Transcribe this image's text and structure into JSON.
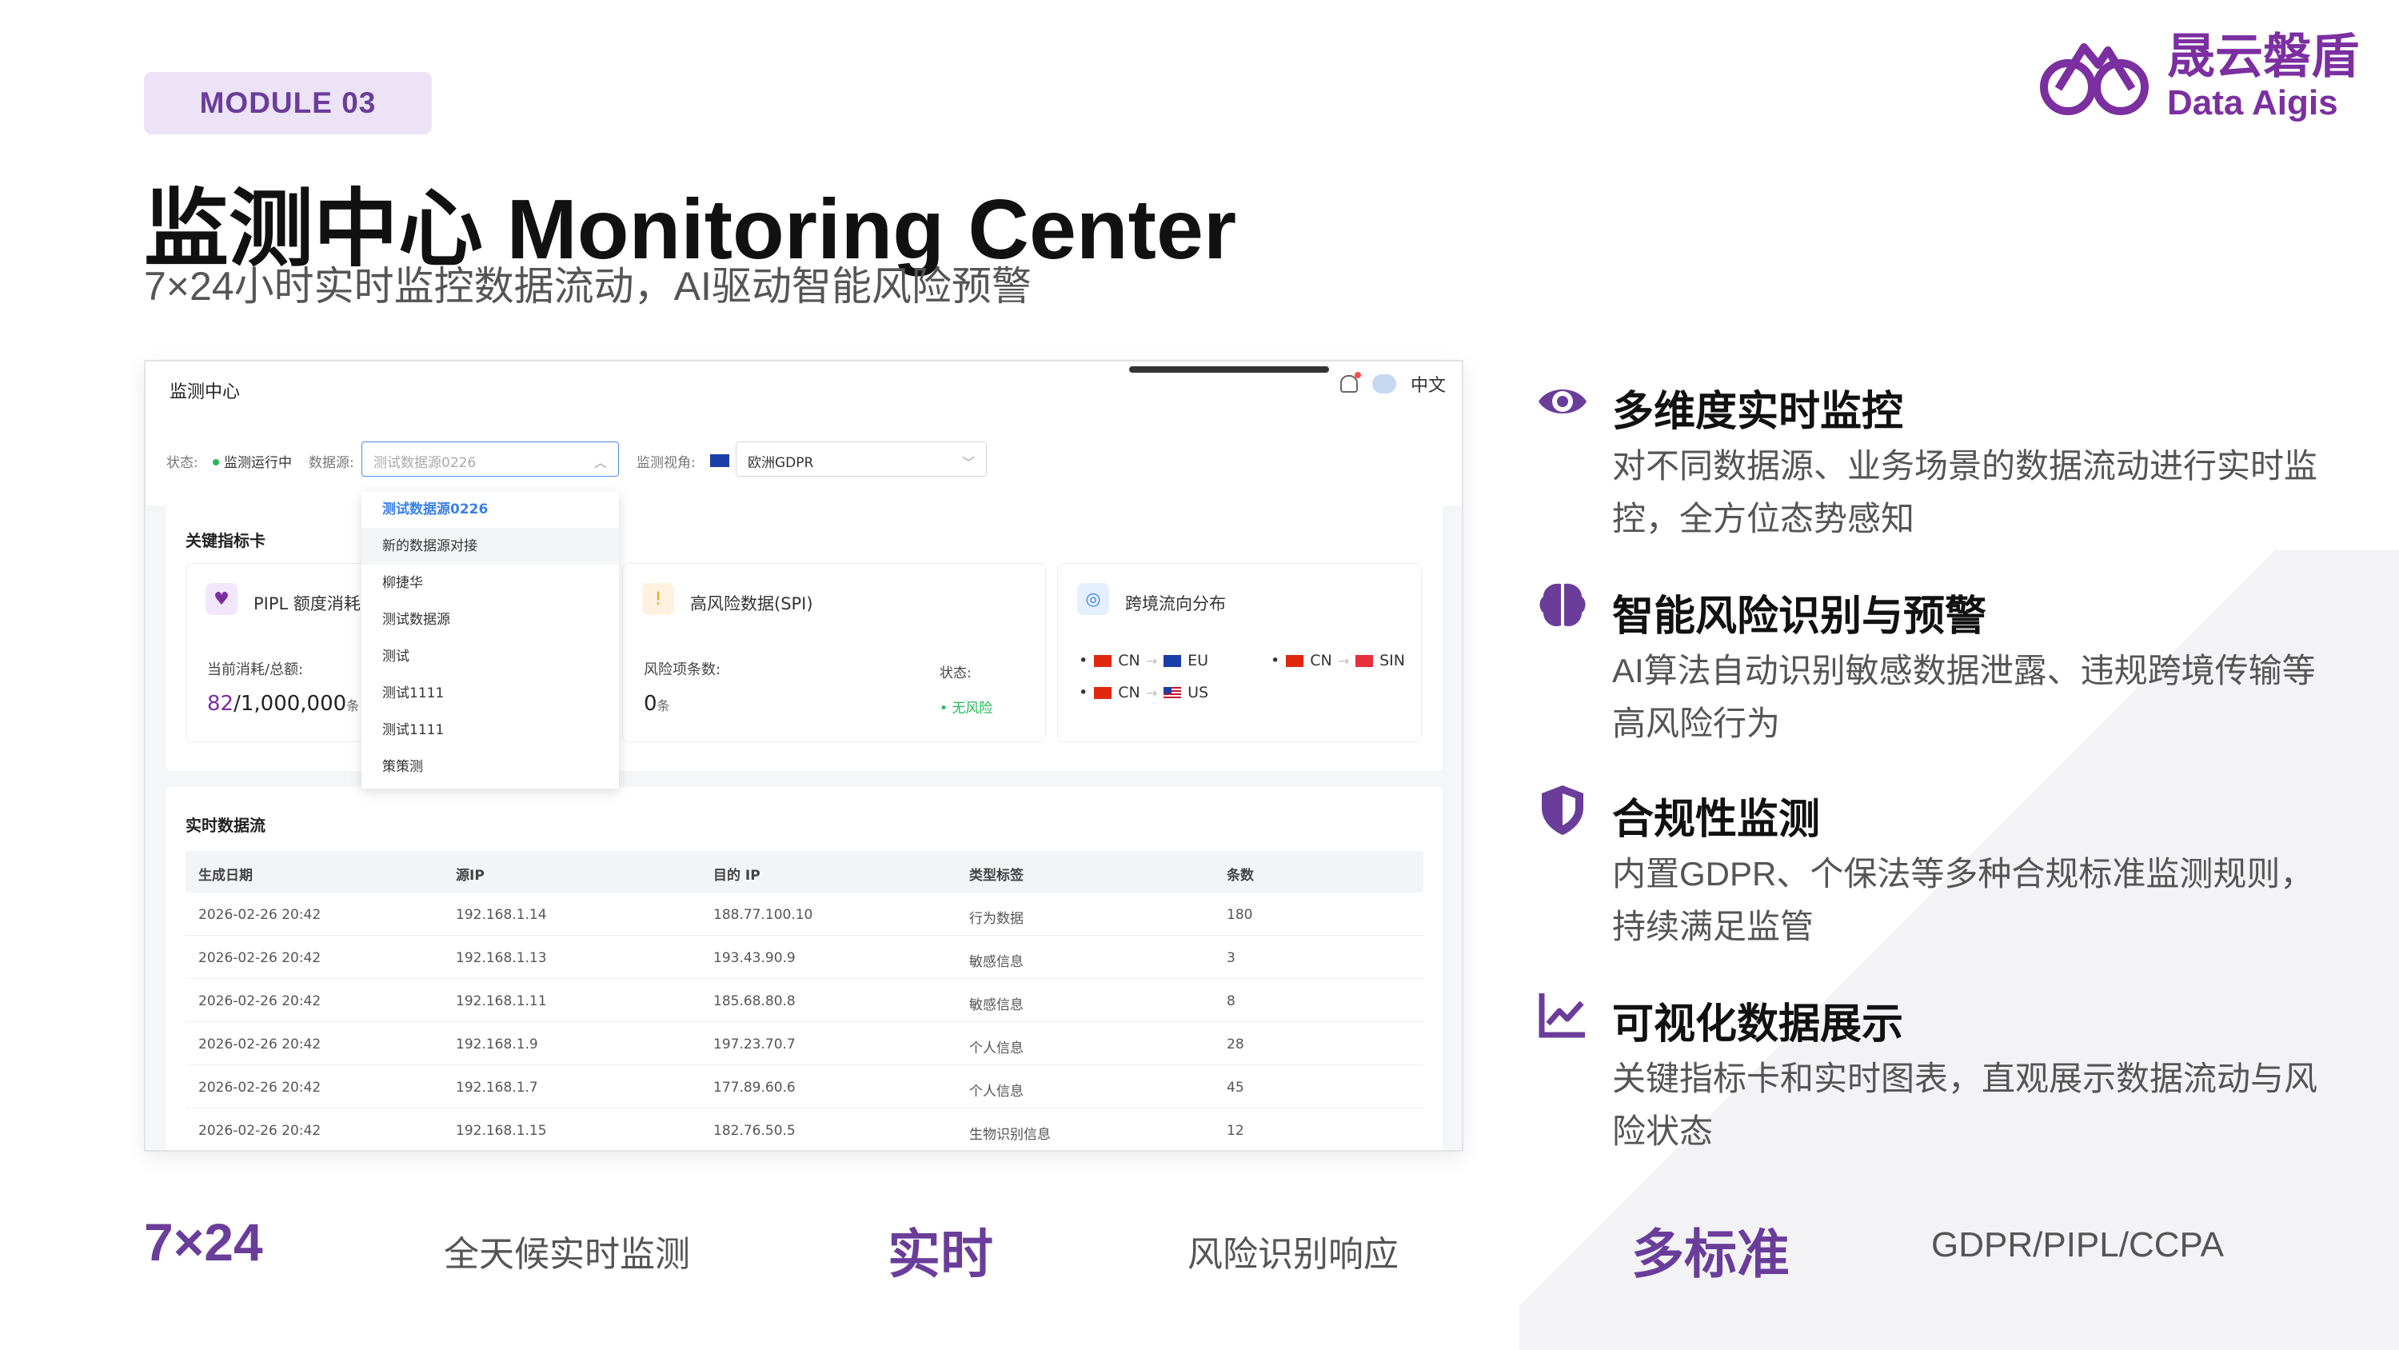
{
  "header": {
    "module_tag": "MODULE 03",
    "title": "监测中心  Monitoring Center",
    "subtitle": "7×24小时实时监控数据流动，AI驱动智能风险预警"
  },
  "logo": {
    "cn": "晟云磐盾",
    "en": "Data Aigis",
    "brand_color": "#7b2fa0"
  },
  "screen": {
    "page_title": "监测中心",
    "language": "中文",
    "filter": {
      "status_label": "状态:",
      "status_value": "监测运行中",
      "source_label": "数据源:",
      "source_placeholder": "测试数据源0226",
      "view_label": "监测视角:",
      "view_value": "欧洲GDPR"
    },
    "dropdown_options": [
      "测试数据源0226",
      "新的数据源对接",
      "柳捷华",
      "测试数据源",
      "测试",
      "测试1111",
      "测试1111",
      "策策测"
    ],
    "metrics_title": "关键指标卡",
    "metrics": {
      "pipl": {
        "title": "PIPL 额度消耗",
        "label": "当前消耗/总额:",
        "used": "82",
        "total": "/1,000,000",
        "unit": "条"
      },
      "spi": {
        "title": "高风险数据(SPI)",
        "label": "风险项条数:",
        "value": "0",
        "unit": "条",
        "status_label": "状态:",
        "status_value": "无风险"
      },
      "cross": {
        "title": "跨境流向分布",
        "flows": [
          {
            "from": "CN",
            "to": "EU"
          },
          {
            "from": "CN",
            "to": "SIN"
          },
          {
            "from": "CN",
            "to": "US"
          }
        ]
      }
    },
    "table": {
      "title": "实时数据流",
      "columns": [
        "生成日期",
        "源IP",
        "目的 IP",
        "类型标签",
        "条数"
      ],
      "rows": [
        [
          "2026-02-26 20:42",
          "192.168.1.14",
          "188.77.100.10",
          "行为数据",
          "180"
        ],
        [
          "2026-02-26 20:42",
          "192.168.1.13",
          "193.43.90.9",
          "敏感信息",
          "3"
        ],
        [
          "2026-02-26 20:42",
          "192.168.1.11",
          "185.68.80.8",
          "敏感信息",
          "8"
        ],
        [
          "2026-02-26 20:42",
          "192.168.1.9",
          "197.23.70.7",
          "个人信息",
          "28"
        ],
        [
          "2026-02-26 20:42",
          "192.168.1.7",
          "177.89.60.6",
          "个人信息",
          "45"
        ],
        [
          "2026-02-26 20:42",
          "192.168.1.15",
          "182.76.50.5",
          "生物识别信息",
          "12"
        ]
      ]
    }
  },
  "features": [
    {
      "icon": "eye-icon",
      "title": "多维度实时监控",
      "desc": "对不同数据源、业务场景的数据流动进行实时监控，全方位态势感知"
    },
    {
      "icon": "brain-icon",
      "title": "智能风险识别与预警",
      "desc": "AI算法自动识别敏感数据泄露、违规跨境传输等高风险行为"
    },
    {
      "icon": "shield-icon",
      "title": "合规性监测",
      "desc": "内置GDPR、个保法等多种合规标准监测规则，持续满足监管"
    },
    {
      "icon": "chart-icon",
      "title": "可视化数据展示",
      "desc": "关键指标卡和实时图表，直观展示数据流动与风险状态"
    }
  ],
  "stats": [
    {
      "value": "7×24",
      "label": "全天候实时监测"
    },
    {
      "value": "实时",
      "label": "风险识别响应"
    },
    {
      "value": "多标准",
      "label": "GDPR/PIPL/CCPA"
    }
  ],
  "colors": {
    "accent": "#6a3d9a",
    "tag_bg": "#ece3f6",
    "ok": "#22bb55",
    "link": "#3a80e8"
  }
}
